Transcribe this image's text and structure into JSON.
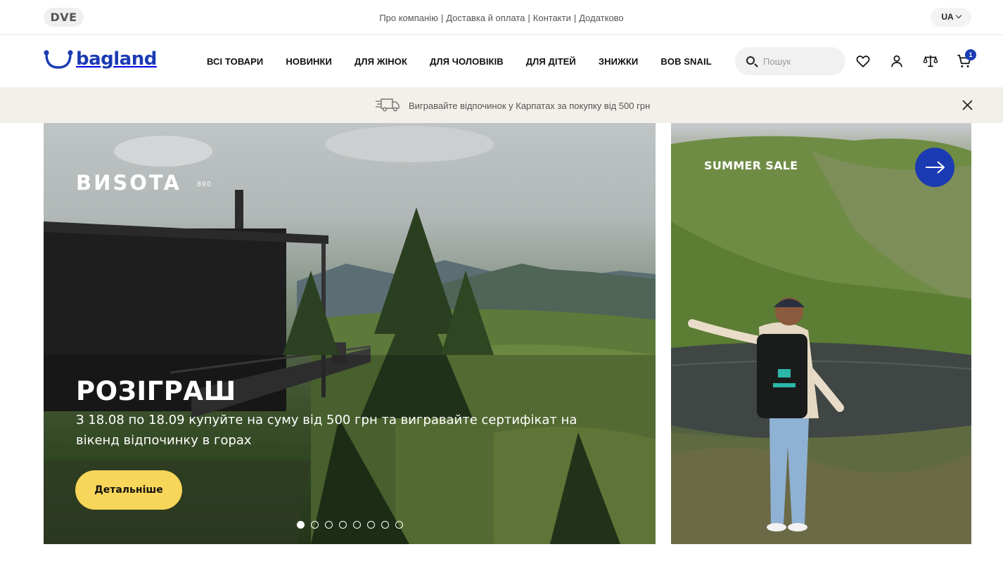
{
  "topbar": {
    "badge": "DVE",
    "links": [
      "Про компанію",
      "Доставка й оплата",
      "Контакти",
      "Додатково"
    ],
    "separator": "|",
    "language": "UA"
  },
  "header": {
    "logo_text": "bagland",
    "nav": [
      "ВСІ ТОВАРИ",
      "НОВИНКИ",
      "ДЛЯ ЖІНОК",
      "ДЛЯ ЧОЛОВІКІВ",
      "ДЛЯ ДІТЕЙ",
      "ЗНИЖКИ",
      "BOB SNAIL"
    ],
    "search_placeholder": "Пошук",
    "cart_count": "1",
    "icons": [
      "search-icon",
      "heart-icon",
      "user-icon",
      "compare-scales-icon",
      "cart-icon"
    ]
  },
  "promo": {
    "icon": "delivery-truck-icon",
    "text": "Вигравайте відпочинок у Карпатах за покупку від 500 грн"
  },
  "hero": {
    "brand": "ВИSOTA",
    "brand_sub": "890",
    "title": "РОЗІГРАШ",
    "description": "З 18.08 по 18.09 купуйте на суму від 500 грн та вигравайте сертифікат на вікенд відпочинку в горах",
    "cta_label": "Детальніше",
    "slide_count": 8,
    "active_slide": 1
  },
  "side_banner": {
    "label": "SUMMER SALE"
  },
  "colors": {
    "brand_blue": "#1b3bb3",
    "cta_yellow": "#f8d65a",
    "promo_bg": "#f3f0ea"
  }
}
